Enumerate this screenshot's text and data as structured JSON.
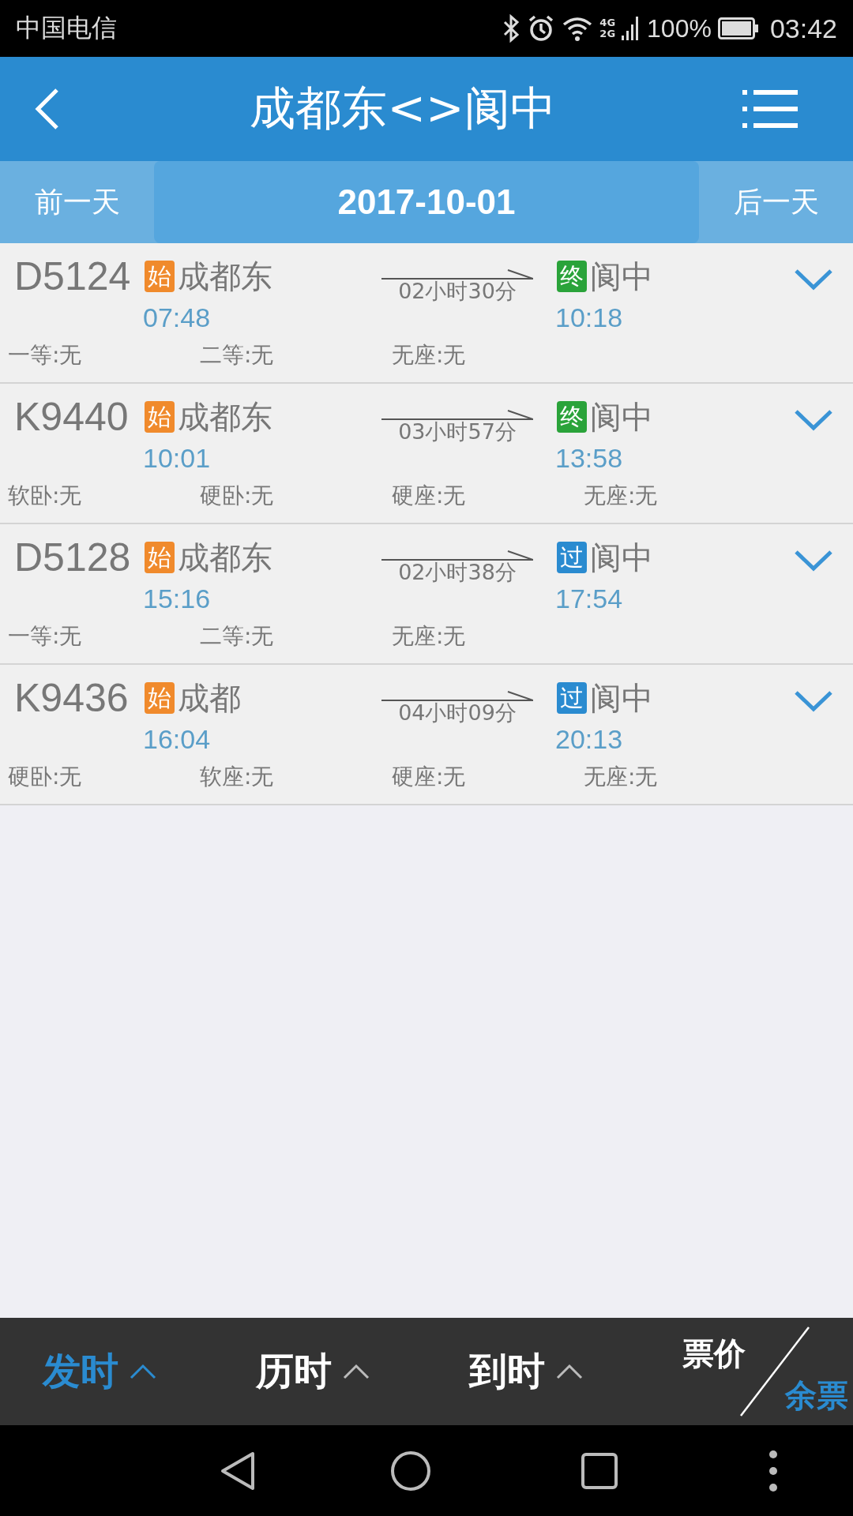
{
  "status_bar": {
    "carrier": "中国电信",
    "network_top": "4G",
    "network_bottom": "2G",
    "battery": "100%",
    "time": "03:42"
  },
  "header": {
    "title": "成都东<>阆中"
  },
  "date_bar": {
    "prev": "前一天",
    "date": "2017-10-01",
    "next": "后一天"
  },
  "trains": [
    {
      "number": "D5124",
      "from_badge": {
        "text": "始",
        "kind": "origin"
      },
      "from": "成都东",
      "depart": "07:48",
      "duration": "02小时30分",
      "to_badge": {
        "text": "终",
        "kind": "terminal"
      },
      "to": "阆中",
      "arrive": "10:18",
      "seats": [
        "一等:无",
        "二等:无",
        "无座:无"
      ]
    },
    {
      "number": "K9440",
      "from_badge": {
        "text": "始",
        "kind": "origin"
      },
      "from": "成都东",
      "depart": "10:01",
      "duration": "03小时57分",
      "to_badge": {
        "text": "终",
        "kind": "terminal"
      },
      "to": "阆中",
      "arrive": "13:58",
      "seats": [
        "软卧:无",
        "硬卧:无",
        "硬座:无",
        "无座:无"
      ]
    },
    {
      "number": "D5128",
      "from_badge": {
        "text": "始",
        "kind": "origin"
      },
      "from": "成都东",
      "depart": "15:16",
      "duration": "02小时38分",
      "to_badge": {
        "text": "过",
        "kind": "pass"
      },
      "to": "阆中",
      "arrive": "17:54",
      "seats": [
        "一等:无",
        "二等:无",
        "无座:无"
      ]
    },
    {
      "number": "K9436",
      "from_badge": {
        "text": "始",
        "kind": "origin"
      },
      "from": "成都",
      "depart": "16:04",
      "duration": "04小时09分",
      "to_badge": {
        "text": "过",
        "kind": "pass"
      },
      "to": "阆中",
      "arrive": "20:13",
      "seats": [
        "硬卧:无",
        "软座:无",
        "硬座:无",
        "无座:无"
      ]
    }
  ],
  "sort_bar": [
    {
      "kind": "arrow",
      "label": "发时",
      "selected": true
    },
    {
      "kind": "arrow",
      "label": "历时",
      "selected": false
    },
    {
      "kind": "arrow",
      "label": "到时",
      "selected": false
    },
    {
      "kind": "split",
      "top": {
        "label": "票价",
        "selected": false
      },
      "bottom": {
        "label": "余票",
        "selected": true
      }
    }
  ]
}
